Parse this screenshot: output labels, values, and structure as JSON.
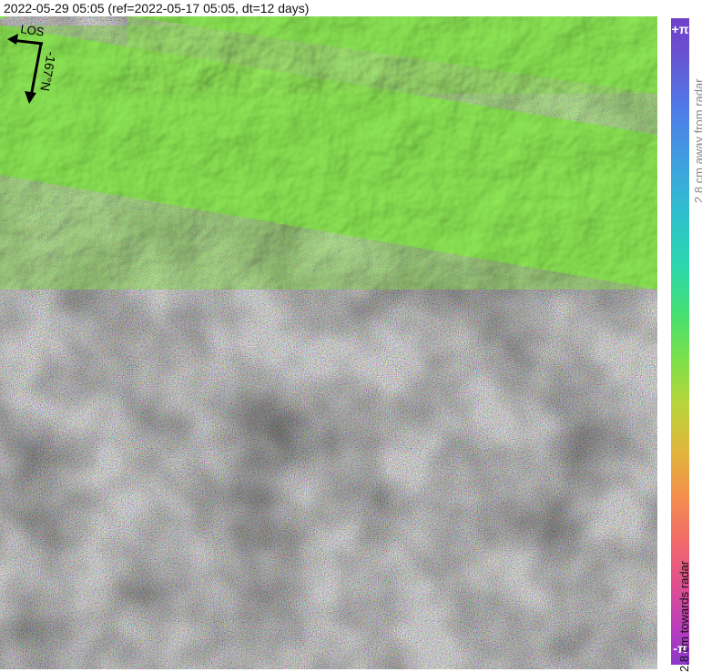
{
  "title": "2022-05-29 05:05 (ref=2022-05-17 05:05, dt=12 days)",
  "colorbar": {
    "top_label": "+π",
    "bottom_label": "-π",
    "away_text": "2.8 cm away from radar",
    "towards_text": "2.8 cm towards radar"
  },
  "north_arrow": {
    "los_label": "LOS",
    "heading_label": "-167°N"
  },
  "colors": {
    "terrain_green": "#7ee04a",
    "noise_base": "#6f7a5a"
  }
}
